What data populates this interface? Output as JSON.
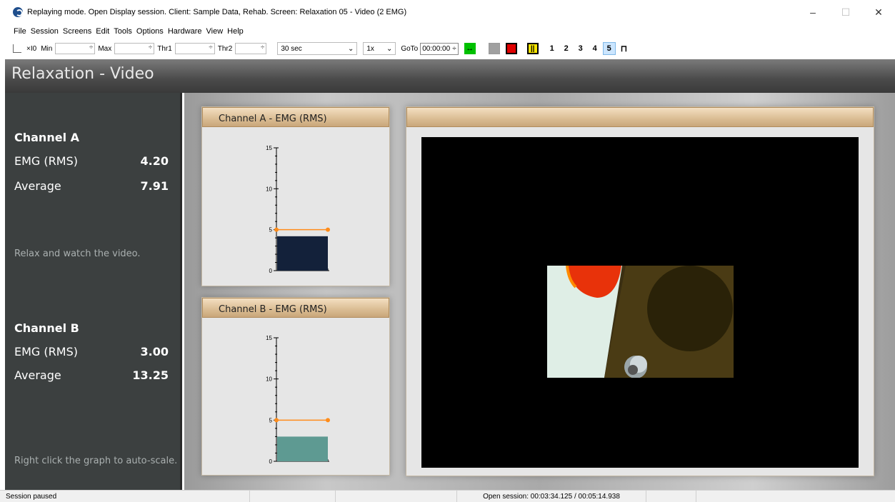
{
  "window": {
    "title": "Replaying mode. Open Display session. Client: Sample Data, Rehab. Screen: Relaxation 05 - Video (2 EMG)",
    "minimize": "–",
    "maximize": "☐",
    "close": "✕"
  },
  "menu": [
    "File",
    "Session",
    "Screens",
    "Edit",
    "Tools",
    "Options",
    "Hardware",
    "View",
    "Help"
  ],
  "toolbar": {
    "scale_label": "×I0",
    "min_label": "Min",
    "max_label": "Max",
    "thr1_label": "Thr1",
    "thr2_label": "Thr2",
    "time_window": "30 sec",
    "speed": "1x",
    "goto_label": "GoTo",
    "goto_value": "00:00:00",
    "screen_numbers": [
      "1",
      "2",
      "3",
      "4",
      "5"
    ],
    "active_screen": "5",
    "colors": {
      "green": "#00c000",
      "red": "#e00000",
      "yellow": "#f5e400",
      "gray": "#a0a0a0"
    }
  },
  "screen_title": "Relaxation - Video",
  "left_panel": {
    "channel_a": {
      "heading": "Channel A",
      "emg_label": "EMG (RMS)",
      "emg_value": "4.20",
      "avg_label": "Average",
      "avg_value": "7.91"
    },
    "instruction_1": "Relax and watch the video.",
    "channel_b": {
      "heading": "Channel B",
      "emg_label": "EMG (RMS)",
      "emg_value": "3.00",
      "avg_label": "Average",
      "avg_value": "13.25"
    },
    "instruction_2": "Right click the graph to auto-scale."
  },
  "charts": {
    "a_title": "Channel A - EMG (RMS)",
    "b_title": "Channel B - EMG (RMS)",
    "video_title": ""
  },
  "chart_data": [
    {
      "type": "bar",
      "title": "Channel A - EMG (RMS)",
      "values": [
        4.2
      ],
      "threshold": 5,
      "ylim": [
        0,
        15
      ],
      "yticks": [
        "0",
        "5",
        "10",
        "15"
      ],
      "bar_color": "#13213a",
      "threshold_color": "#ff8c1a"
    },
    {
      "type": "bar",
      "title": "Channel B - EMG (RMS)",
      "values": [
        3.0
      ],
      "threshold": 5,
      "ylim": [
        0,
        15
      ],
      "yticks": [
        "0",
        "5",
        "10",
        "15"
      ],
      "bar_color": "#5e9a92",
      "threshold_color": "#ff8c1a"
    }
  ],
  "status": {
    "left": "Session paused",
    "session_time": "Open session: 00:03:34.125 / 00:05:14.938"
  }
}
